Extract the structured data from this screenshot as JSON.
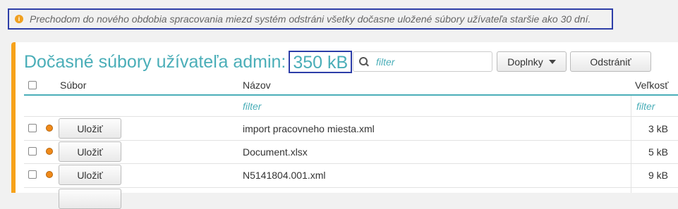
{
  "notice": {
    "icon": "info-icon",
    "text": "Prechodom do nového obdobia spracovania miezd systém odstráni všetky dočasne uložené súbory užívateľa staršie ako 30 dní."
  },
  "header": {
    "title": "Dočasné súbory užívateľa admin:",
    "total_size": "350 kB",
    "filter_placeholder": "filter",
    "addons_label": "Doplnky",
    "remove_label": "Odstrániť"
  },
  "table": {
    "columns": {
      "file": "Súbor",
      "name": "Názov",
      "size": "Veľkosť"
    },
    "filter_name": "filter",
    "filter_size": "filter",
    "rows": [
      {
        "save_label": "Uložiť",
        "name": "import pracovneho miesta.xml",
        "size": "3 kB"
      },
      {
        "save_label": "Uložiť",
        "name": "Document.xlsx",
        "size": "5 kB"
      },
      {
        "save_label": "Uložiť",
        "name": "N5141804.001.xml",
        "size": "9 kB"
      },
      {
        "save_label": "",
        "name": "",
        "size": ""
      }
    ]
  },
  "colors": {
    "accent": "#4aaeb8",
    "orange": "#f7a21a",
    "highlight_border": "#2d3ea8",
    "status_dot": "#f08a1a"
  }
}
